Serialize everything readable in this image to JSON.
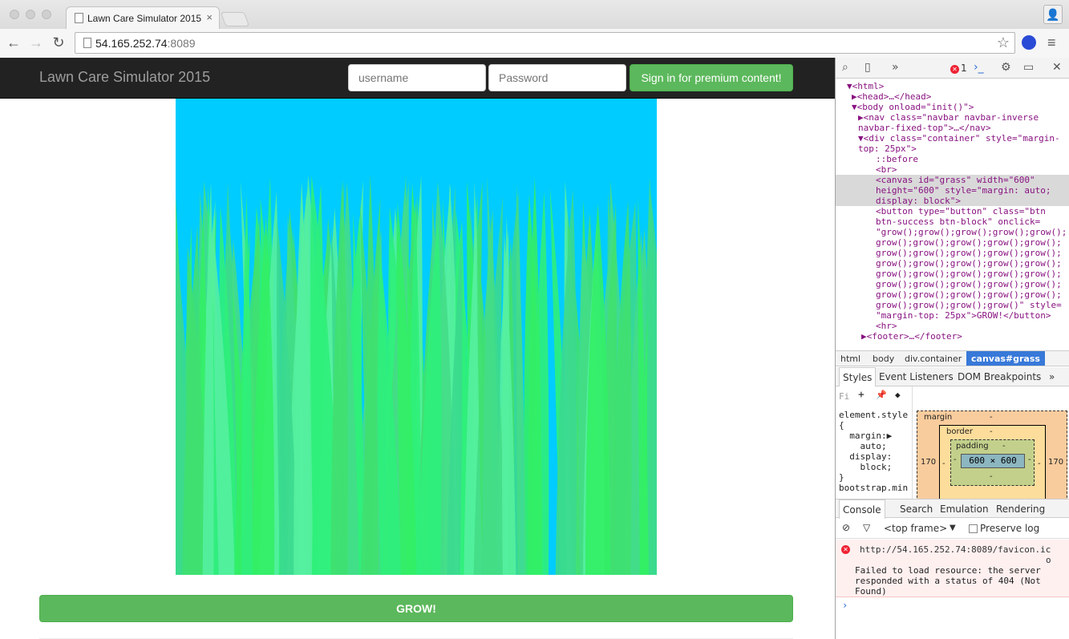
{
  "browser": {
    "tab_title": "Lawn Care Simulator 2015",
    "tab_close": "×",
    "url_host": "54.165.252.74",
    "url_port": ":8089",
    "back_glyph": "←",
    "forward_glyph": "→",
    "reload_glyph": "↻",
    "star_glyph": "☆",
    "menu_glyph": "≡",
    "profile_glyph": "👤"
  },
  "navbar": {
    "brand": "Lawn Care Simulator 2015",
    "username_placeholder": "username",
    "password_placeholder": "Password",
    "signin_label": "Sign in for premium content!"
  },
  "main": {
    "grow_label": "GROW!",
    "canvas": {
      "sky_color": "#00ccff",
      "grass_colors": [
        "#33ee66",
        "#44dd88",
        "#2ff07a",
        "#3bd98f",
        "#55f0a0",
        "#40e070"
      ]
    }
  },
  "devtools": {
    "toolbar": {
      "error_count": "1",
      "more_glyph": "»",
      "close_glyph": "✕"
    },
    "dom": [
      {
        "t": "▼<html>",
        "i": 0
      },
      {
        "t": "▶<head>…</head>",
        "i": 1
      },
      {
        "t": "▼<body onload=\"init()\">",
        "i": 1
      },
      {
        "t": "▶<nav class=\"navbar navbar-inverse",
        "i": 2
      },
      {
        "t": "navbar-fixed-top\">…</nav>",
        "i": 2
      },
      {
        "t": "▼<div class=\"container\" style=\"margin-",
        "i": 2
      },
      {
        "t": "top: 25px\">",
        "i": 2
      },
      {
        "t": "::before",
        "i": 4
      },
      {
        "t": "<br>",
        "i": 4
      },
      {
        "t": "<canvas id=\"grass\" width=\"600\"",
        "i": 4
      },
      {
        "t": "height=\"600\" style=\"margin: auto;",
        "i": 4
      },
      {
        "t": "display: block\">",
        "i": 4
      },
      {
        "t": "<button type=\"button\" class=\"btn",
        "i": 4
      },
      {
        "t": "btn-success btn-block\" onclick=",
        "i": 4
      },
      {
        "t": "\"grow();grow();grow();grow();grow();",
        "i": 4
      },
      {
        "t": "grow();grow();grow();grow();grow();",
        "i": 4
      },
      {
        "t": "grow();grow();grow();grow();grow();",
        "i": 4
      },
      {
        "t": "grow();grow();grow();grow();grow();",
        "i": 4
      },
      {
        "t": "grow();grow();grow();grow();grow();",
        "i": 4
      },
      {
        "t": "grow();grow();grow();grow();grow();",
        "i": 4
      },
      {
        "t": "grow();grow();grow();grow();grow();",
        "i": 4
      },
      {
        "t": "grow();grow();grow();grow()\" style=",
        "i": 4
      },
      {
        "t": "\"margin-top: 25px\">GROW!</button>",
        "i": 4
      },
      {
        "t": "<hr>",
        "i": 4
      },
      {
        "t": "▶<footer>…</footer>",
        "i": 3
      }
    ],
    "breadcrumbs": [
      "html",
      "body",
      "div.container",
      "canvas#grass"
    ],
    "subtabs": [
      "Styles",
      "Event Listeners",
      "DOM Breakpoints"
    ],
    "subtabs_more": "»",
    "styles_filter": "Fi",
    "styles": [
      "element.style",
      "{",
      "  margin:▶",
      "    auto;",
      "  display:",
      "    block;",
      "}",
      "bootstrap.min"
    ],
    "box_model": {
      "margin_label": "margin",
      "border_label": "border",
      "padding_label": "padding",
      "dash": "-",
      "content": "600 × 600",
      "margin_left": "170",
      "margin_right": "170"
    },
    "console_tabs": [
      "Console",
      "Search",
      "Emulation",
      "Rendering"
    ],
    "frame_select": "<top frame>",
    "frame_caret": "▼",
    "preserve_log": "Preserve log",
    "error_url": "http://54.165.252.74:8089/favicon.ic",
    "error_url_tail": "o",
    "error_lines": [
      "Failed to load resource: the server",
      "responded with a status of 404 (Not",
      "Found)"
    ],
    "prompt": "›"
  }
}
